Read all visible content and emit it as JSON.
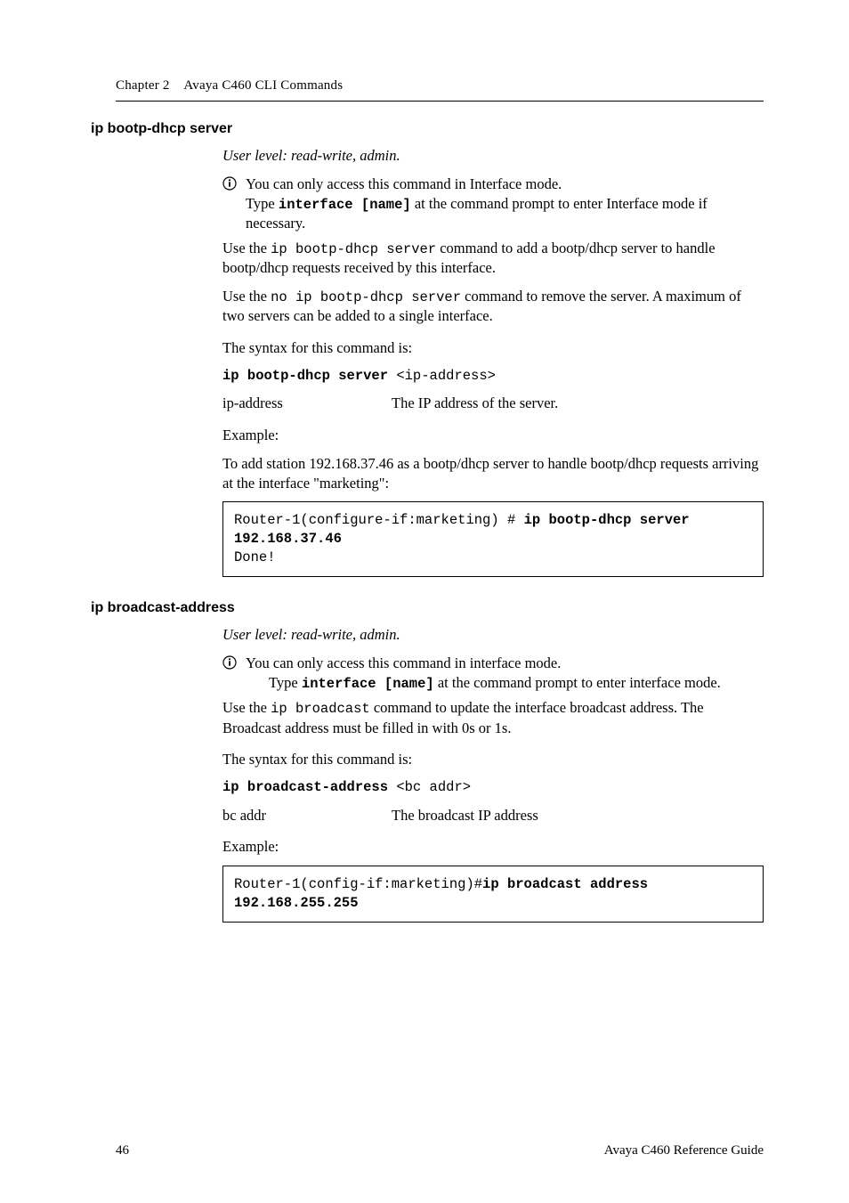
{
  "header": {
    "chapter_label": "Chapter 2",
    "chapter_title": "Avaya C460 CLI Commands"
  },
  "section1": {
    "title": "ip bootp-dhcp server",
    "user_level": "User level: read-write, admin.",
    "info_line1": "You can only access this command in Interface mode.",
    "info_line2a": "Type ",
    "info_line2_cmd": "interface [name]",
    "info_line2b": " at the command prompt to enter Interface mode if necessary.",
    "para1a": "Use the ",
    "para1_cmd": "ip bootp-dhcp server",
    "para1b": " command to add a bootp/dhcp server to handle bootp/dhcp requests received by this interface.",
    "para2a": "Use the ",
    "para2_cmd": "no ip bootp-dhcp server",
    "para2b": " command to remove the server. A maximum of two servers can be added to a single interface.",
    "syntax_intro": "The syntax for this command is:",
    "syntax_cmd": "ip bootp-dhcp server",
    "syntax_arg": " <ip-address>",
    "param_label": "ip-address",
    "param_desc": "The IP address of the server.",
    "example_label": "Example:",
    "example_desc": "To add station 192.168.37.46 as a bootp/dhcp server to handle bootp/dhcp requests arriving at the interface \"marketing\":",
    "code_prefix": "Router-1(configure-if:marketing) # ",
    "code_bold": "ip bootp-dhcp server 192.168.37.46",
    "code_after": "Done!"
  },
  "section2": {
    "title": "ip broadcast-address",
    "user_level": "User level: read-write, admin.",
    "info_line1": "You can only access this command in interface mode.",
    "info_line2a": "Type ",
    "info_line2_cmd": "interface [name]",
    "info_line2b": " at the command prompt to enter interface mode.",
    "para1a": "Use the ",
    "para1_cmd": "ip broadcast",
    "para1b": " command to update the interface broadcast address. The Broadcast address must be filled in with 0s or 1s.",
    "syntax_intro": "The syntax for this command is:",
    "syntax_cmd": "ip broadcast-address",
    "syntax_arg": " <bc addr>",
    "param_label": "bc addr",
    "param_desc": "The broadcast IP address",
    "example_label": "Example:",
    "code_prefix": "Router-1(config-if:marketing)#",
    "code_bold": "ip broadcast address 192.168.255.255"
  },
  "footer": {
    "page_number": "46",
    "doc_title": "Avaya C460 Reference Guide"
  }
}
